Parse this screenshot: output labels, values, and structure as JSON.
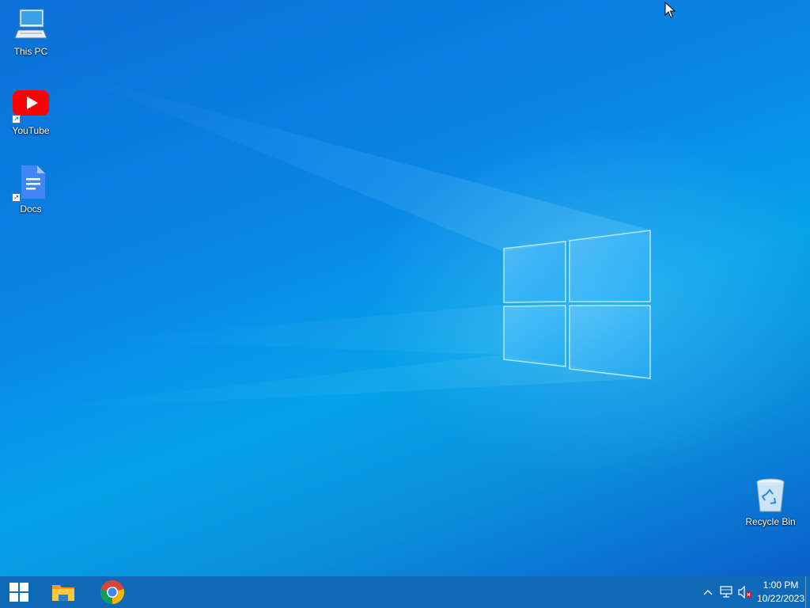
{
  "desktop": {
    "icons": [
      {
        "label": "This PC",
        "icon": "this-pc-icon"
      },
      {
        "label": "YouTube",
        "icon": "youtube-icon",
        "shortcut": true
      },
      {
        "label": "Docs",
        "icon": "google-docs-icon",
        "shortcut": true
      },
      {
        "label": "Recycle Bin",
        "icon": "recycle-bin-icon"
      }
    ],
    "wallpaper": "windows-10-hero-light",
    "accent_colors": {
      "wallpaper_top": "#0b6fd8",
      "wallpaper_mid": "#05a2ea",
      "taskbar": "#1069b6"
    }
  },
  "taskbar": {
    "start_icon": "windows-start-icon",
    "pinned": [
      {
        "name": "File Explorer",
        "icon": "file-explorer-icon"
      },
      {
        "name": "Google Chrome",
        "icon": "chrome-icon"
      }
    ],
    "tray": {
      "overflow_icon": "chevron-up-icon",
      "network_icon": "network-disconnected-icon",
      "volume_icon": "volume-muted-icon",
      "time": "1:00 PM",
      "date": "10/22/2023"
    }
  }
}
